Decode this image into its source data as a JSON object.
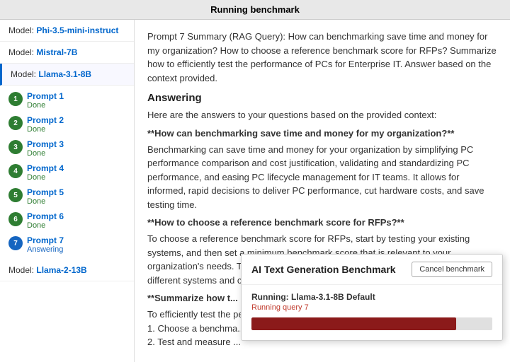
{
  "titleBar": {
    "label": "Running benchmark"
  },
  "sidebar": {
    "models": [
      {
        "id": "phi",
        "prefix": "Model:",
        "name": "Phi-3.5-mini-instruct",
        "active": false,
        "hasPrompts": false
      },
      {
        "id": "mistral",
        "prefix": "Model:",
        "name": "Mistral-7B",
        "active": false,
        "hasPrompts": false
      },
      {
        "id": "llama31",
        "prefix": "Model:",
        "name": "Llama-3.1-8B",
        "active": true,
        "hasPrompts": true
      },
      {
        "id": "llama2",
        "prefix": "Model:",
        "name": "Llama-2-13B",
        "active": false,
        "hasPrompts": false
      }
    ],
    "prompts": [
      {
        "num": "1",
        "name": "Prompt 1",
        "status": "Done",
        "statusType": "done"
      },
      {
        "num": "2",
        "name": "Prompt 2",
        "status": "Done",
        "statusType": "done"
      },
      {
        "num": "3",
        "name": "Prompt 3",
        "status": "Done",
        "statusType": "done"
      },
      {
        "num": "4",
        "name": "Prompt 4",
        "status": "Done",
        "statusType": "done"
      },
      {
        "num": "5",
        "name": "Prompt 5",
        "status": "Done",
        "statusType": "done"
      },
      {
        "num": "6",
        "name": "Prompt 6",
        "status": "Done",
        "statusType": "done"
      },
      {
        "num": "7",
        "name": "Prompt 7",
        "status": "Answering",
        "statusType": "answering"
      }
    ]
  },
  "content": {
    "promptSummary": "Prompt 7 Summary (RAG Query): How can benchmarking save time and money for my organization? How to choose a reference benchmark score for RFPs? Summarize how to  efficiently test the performance of PCs for Enterprise IT. Answer based on the context provided.",
    "sectionAnswering": "Answering",
    "introText": "Here are the answers to your questions based on the provided context:",
    "q1": "**How can benchmarking save time and money for my organization?**",
    "a1": "Benchmarking can save time and money for your organization by simplifying PC performance comparison and cost justification, validating and standardizing PC performance, and easing PC lifecycle management for IT teams. It allows for informed, rapid decisions to deliver PC performance, cut hardware costs, and save testing time.",
    "q2": "**How to choose a reference benchmark score for RFPs?**",
    "a2": "To choose a reference benchmark score for RFPs, start by testing your existing systems, and then set a minimum benchmark score that is relevant to your organization's needs. This will help you judge the relative performance and value of different systems and compare competing offers from your suppliers.",
    "q3partial": "**Summarize how t...",
    "a3partial": "To efficiently test the performanc...\n1. Choose a benchma...\n2. Test and measure ..."
  },
  "modal": {
    "title": "AI Text Generation Benchmark",
    "cancelLabel": "Cancel benchmark",
    "runningPrefix": "Running:",
    "runningModel": "Llama-3.1-8B Default",
    "runningQuery": "Running query 7",
    "progressPercent": 85
  }
}
